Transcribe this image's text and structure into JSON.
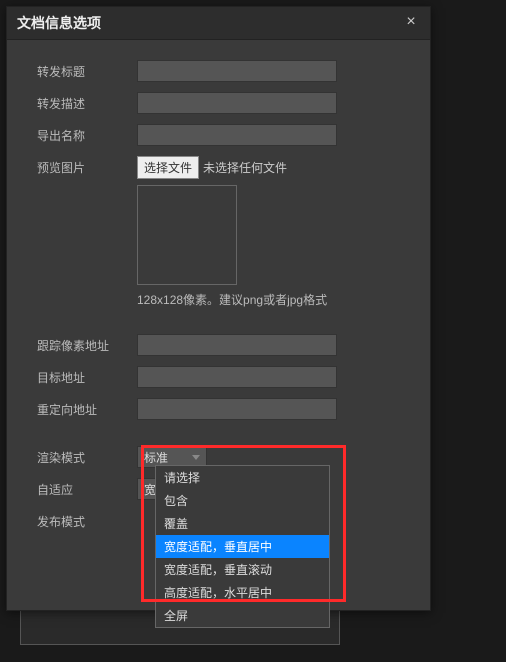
{
  "dialog": {
    "title": "文档信息选项",
    "close": "×"
  },
  "fields": {
    "forward_title": "转发标题",
    "forward_desc": "转发描述",
    "export_name": "导出名称",
    "preview_image": "预览图片",
    "choose_file": "选择文件",
    "no_file": "未选择任何文件",
    "thumb_hint": "128x128像素。建议png或者jpg格式",
    "track_pixel_url": "跟踪像素地址",
    "target_url": "目标地址",
    "redirect_url": "重定向地址",
    "render_mode": "渲染模式",
    "render_mode_value": "标准",
    "adaptive": "自适应",
    "adaptive_value": "宽度适配，垂直居中",
    "publish_mode": "发布模式"
  },
  "adaptive_options": [
    "请选择",
    "包含",
    "覆盖",
    "宽度适配，垂直居中",
    "宽度适配，垂直滚动",
    "高度适配，水平居中",
    "全屏"
  ],
  "adaptive_selected_index": 3
}
